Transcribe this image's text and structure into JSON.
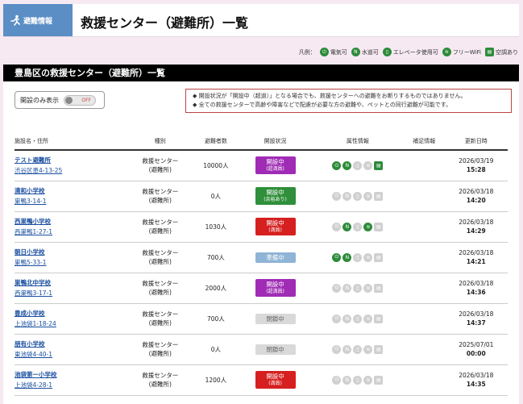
{
  "header": {
    "logo_label": "避難情報",
    "title": "救援センター（避難所）一覧"
  },
  "legend": {
    "label": "凡例：",
    "items": [
      {
        "label": "電気可",
        "icon": "electricity-icon",
        "glyph": "⏻"
      },
      {
        "label": "水道可",
        "icon": "water-icon",
        "glyph": "N"
      },
      {
        "label": "エレベータ使用可",
        "icon": "elevator-icon",
        "glyph": "▯"
      },
      {
        "label": "フリーWiFi",
        "icon": "wifi-icon",
        "glyph": "≋"
      },
      {
        "label": "空調あり",
        "icon": "aircon-icon",
        "glyph": "▤"
      }
    ]
  },
  "panel": {
    "title": "豊島区の救援センター（避難所）一覧",
    "toggle_label": "開設のみ表示",
    "toggle_state": "OFF",
    "notice_lines": [
      "◆ 開設状況が「開設中（超過）」となる場合でも、救援センターへの避難をお断りするものではありません。",
      "◆ 全ての救援センターで高齢や障害などで配慮が必要な方の避難や、ペットとの同行避難が可能です。"
    ]
  },
  "table": {
    "headers": [
      "施設名・住所",
      "種別",
      "避難者数",
      "開設状況",
      "属性情報",
      "補足情報",
      "更新日時"
    ],
    "rows": [
      {
        "name": "テスト避難所",
        "address": "渋谷区恵4-13-25",
        "kind1": "救援センター",
        "kind2": "(避難所)",
        "count": "10000人",
        "status": "開設中",
        "sub": "(超満員)",
        "cls": "b-full",
        "attrs": [
          1,
          1,
          0,
          0,
          1
        ],
        "date": "2026/03/19",
        "time": "15:28"
      },
      {
        "name": "清和小学校",
        "address": "巣鴨3-14-1",
        "kind1": "救援センター",
        "kind2": "(避難所)",
        "count": "0人",
        "status": "開設中",
        "sub": "(余裕あり)",
        "cls": "b-vac",
        "attrs": [
          0,
          0,
          0,
          0,
          0
        ],
        "date": "2026/03/18",
        "time": "14:20"
      },
      {
        "name": "西巣鴨小学校",
        "address": "西巣鴨1-27-1",
        "kind1": "救援センター",
        "kind2": "(避難所)",
        "count": "1030人",
        "status": "開設中",
        "sub": "(満員)",
        "cls": "b-crowd",
        "attrs": [
          0,
          1,
          0,
          1,
          0
        ],
        "date": "2026/03/18",
        "time": "14:29"
      },
      {
        "name": "朝日小学校",
        "address": "巣鴨5-33-1",
        "kind1": "救援センター",
        "kind2": "(避難所)",
        "count": "700人",
        "status": "準備中",
        "sub": "",
        "cls": "b-prep",
        "attrs": [
          1,
          1,
          0,
          0,
          0
        ],
        "date": "2026/03/18",
        "time": "14:21"
      },
      {
        "name": "巣鴨北中学校",
        "address": "西巣鴨3-17-1",
        "kind1": "救援センター",
        "kind2": "(避難所)",
        "count": "2000人",
        "status": "開設中",
        "sub": "(超満員)",
        "cls": "b-full",
        "attrs": [
          0,
          0,
          0,
          0,
          0
        ],
        "date": "2026/03/18",
        "time": "14:36"
      },
      {
        "name": "豊成小学校",
        "address": "上池袋1-18-24",
        "kind1": "救援センター",
        "kind2": "(避難所)",
        "count": "700人",
        "status": "閉鎖中",
        "sub": "",
        "cls": "b-closed",
        "attrs": [
          0,
          0,
          0,
          0,
          0
        ],
        "date": "2026/03/18",
        "time": "14:37"
      },
      {
        "name": "朋有小学校",
        "address": "東池袋4-40-1",
        "kind1": "救援センター",
        "kind2": "(避難所)",
        "count": "0人",
        "status": "閉鎖中",
        "sub": "",
        "cls": "b-closed",
        "attrs": [
          0,
          0,
          0,
          0,
          0
        ],
        "date": "2025/07/01",
        "time": "00:00"
      },
      {
        "name": "池袋第一小学校",
        "address": "上池袋4-28-1",
        "kind1": "救援センター",
        "kind2": "(避難所)",
        "count": "1200人",
        "status": "開設中",
        "sub": "(満員)",
        "cls": "b-crowd",
        "attrs": [
          0,
          0,
          0,
          0,
          0
        ],
        "date": "2026/03/18",
        "time": "14:35"
      }
    ]
  }
}
